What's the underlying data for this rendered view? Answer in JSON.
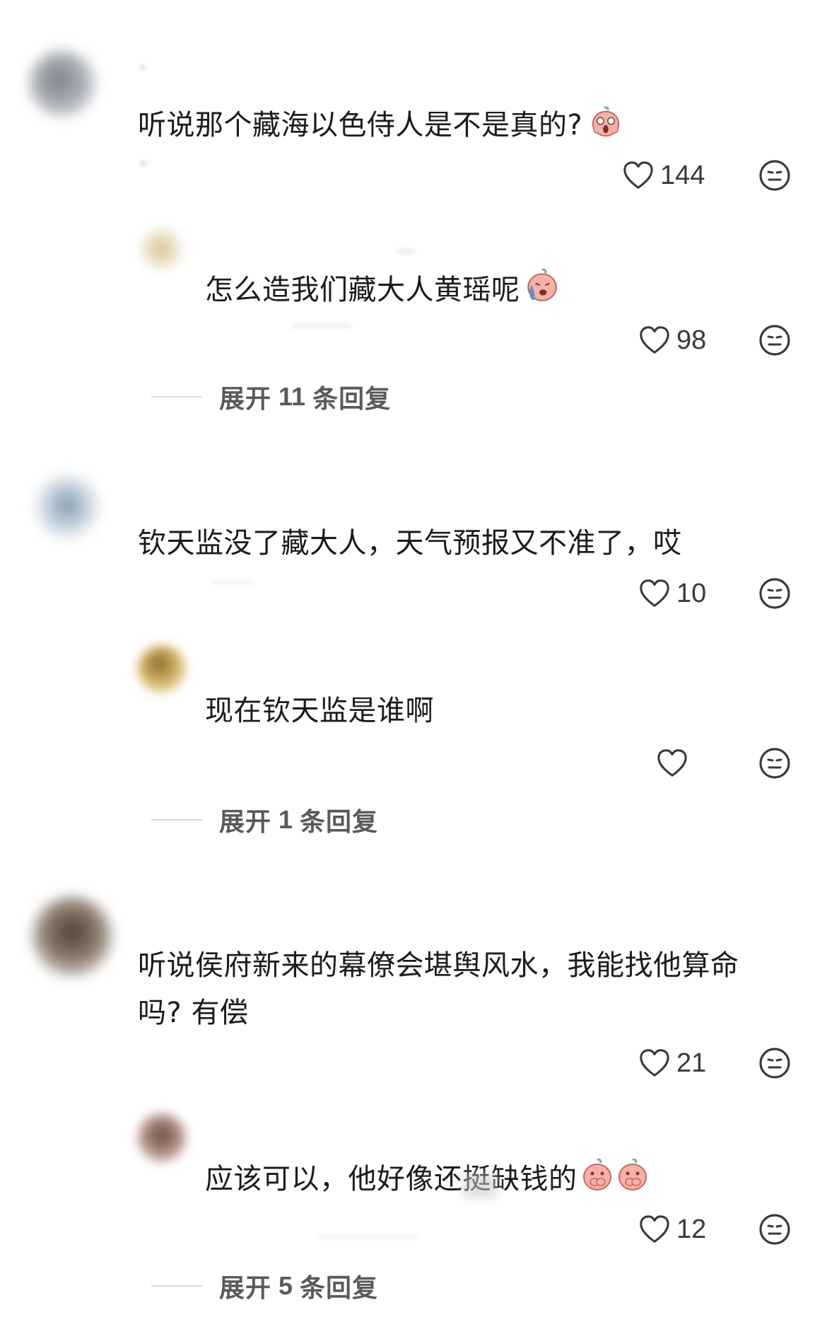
{
  "comments": [
    {
      "text": "听说那个藏海以色侍人是不是真的?",
      "emoji": "scream-emoji",
      "likes": "144",
      "reply": {
        "text": "怎么造我们藏大人黄瑶呢",
        "emoji": "crying-emoji",
        "likes": "98"
      },
      "expand": {
        "prefix": "展开",
        "count": "11",
        "suffix": "条回复"
      }
    },
    {
      "text": "钦天监没了藏大人，天气预报又不准了，哎",
      "likes": "10",
      "reply": {
        "text": "现在钦天监是谁啊",
        "likes": ""
      },
      "expand": {
        "prefix": "展开",
        "count": "1",
        "suffix": "条回复"
      }
    },
    {
      "text_line1": "听说侯府新来的幕僚会堪舆风水，我能找他算命",
      "text_line2": "吗? 有偿",
      "likes": "21",
      "reply": {
        "text": "应该可以，他好像还挺缺钱的",
        "emoji": "covering-mouth-emoji",
        "likes": "12"
      },
      "expand": {
        "prefix": "展开",
        "count": "5",
        "suffix": "条回复"
      }
    }
  ],
  "icons": {
    "like": "heart-outline-icon",
    "dislike": "neutral-face-icon"
  },
  "colors": {
    "text": "#1b1b1b",
    "count": "#3a3a3a",
    "muted": "#5a5a5a",
    "emoji_skin": "#f3a49c"
  }
}
